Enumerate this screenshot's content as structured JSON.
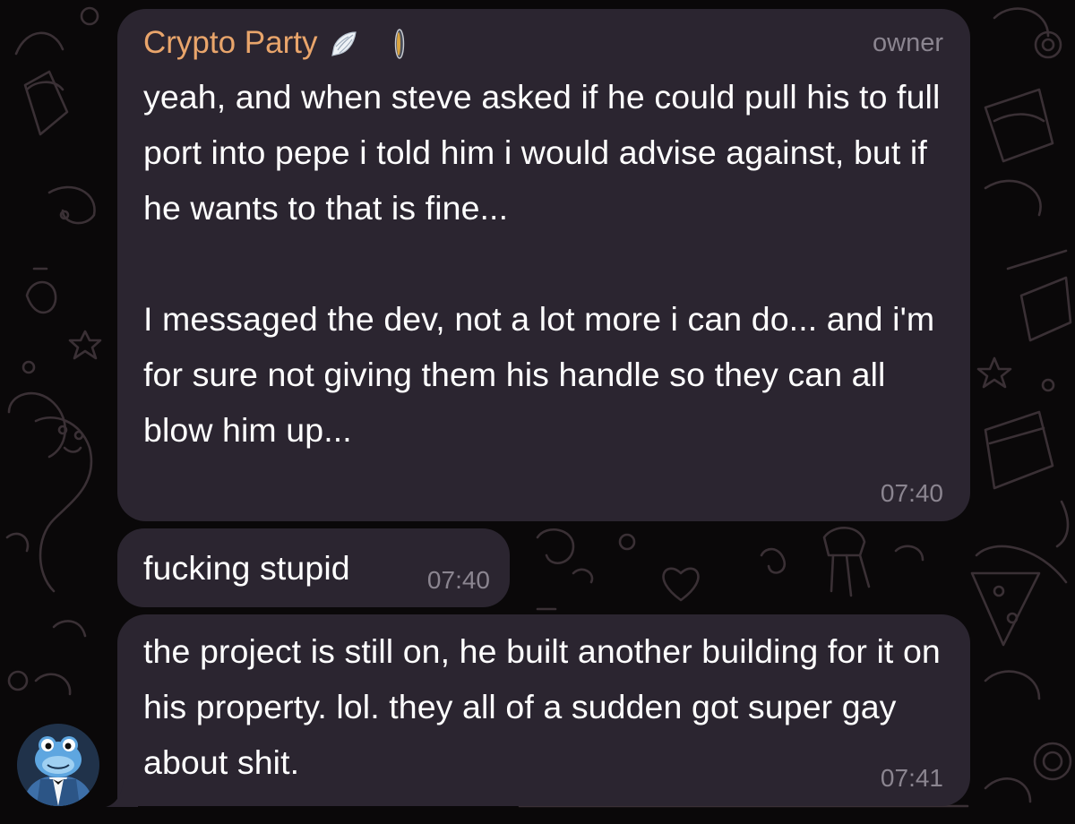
{
  "chat": {
    "messages": [
      {
        "sender": "Crypto Party",
        "role": "owner",
        "text": "yeah, and when steve asked if he could pull his to full port into pepe i told him i would advise against, but if he wants to that is fine...\n\nI messaged the dev, not a lot more i can do... and i'm for sure not giving them his handle so they can all blow him up...",
        "time": "07:40"
      },
      {
        "text": "fucking stupid",
        "time": "07:40"
      },
      {
        "text": "the project is still on, he built another building for it on his property. lol. they all of a sudden got super gay about shit.",
        "time": "07:41"
      }
    ]
  },
  "colors": {
    "background": "#0a0809",
    "bubble": "#2b2530",
    "sender_name": "#e9a56b",
    "text": "#ffffff",
    "meta": "#8b8590",
    "doodle": "#3a3035"
  },
  "icons": {
    "sender_badge_1": "angel-wing-icon",
    "sender_badge_2": "coin-icon",
    "avatar": "frog-in-tuxedo-avatar"
  }
}
